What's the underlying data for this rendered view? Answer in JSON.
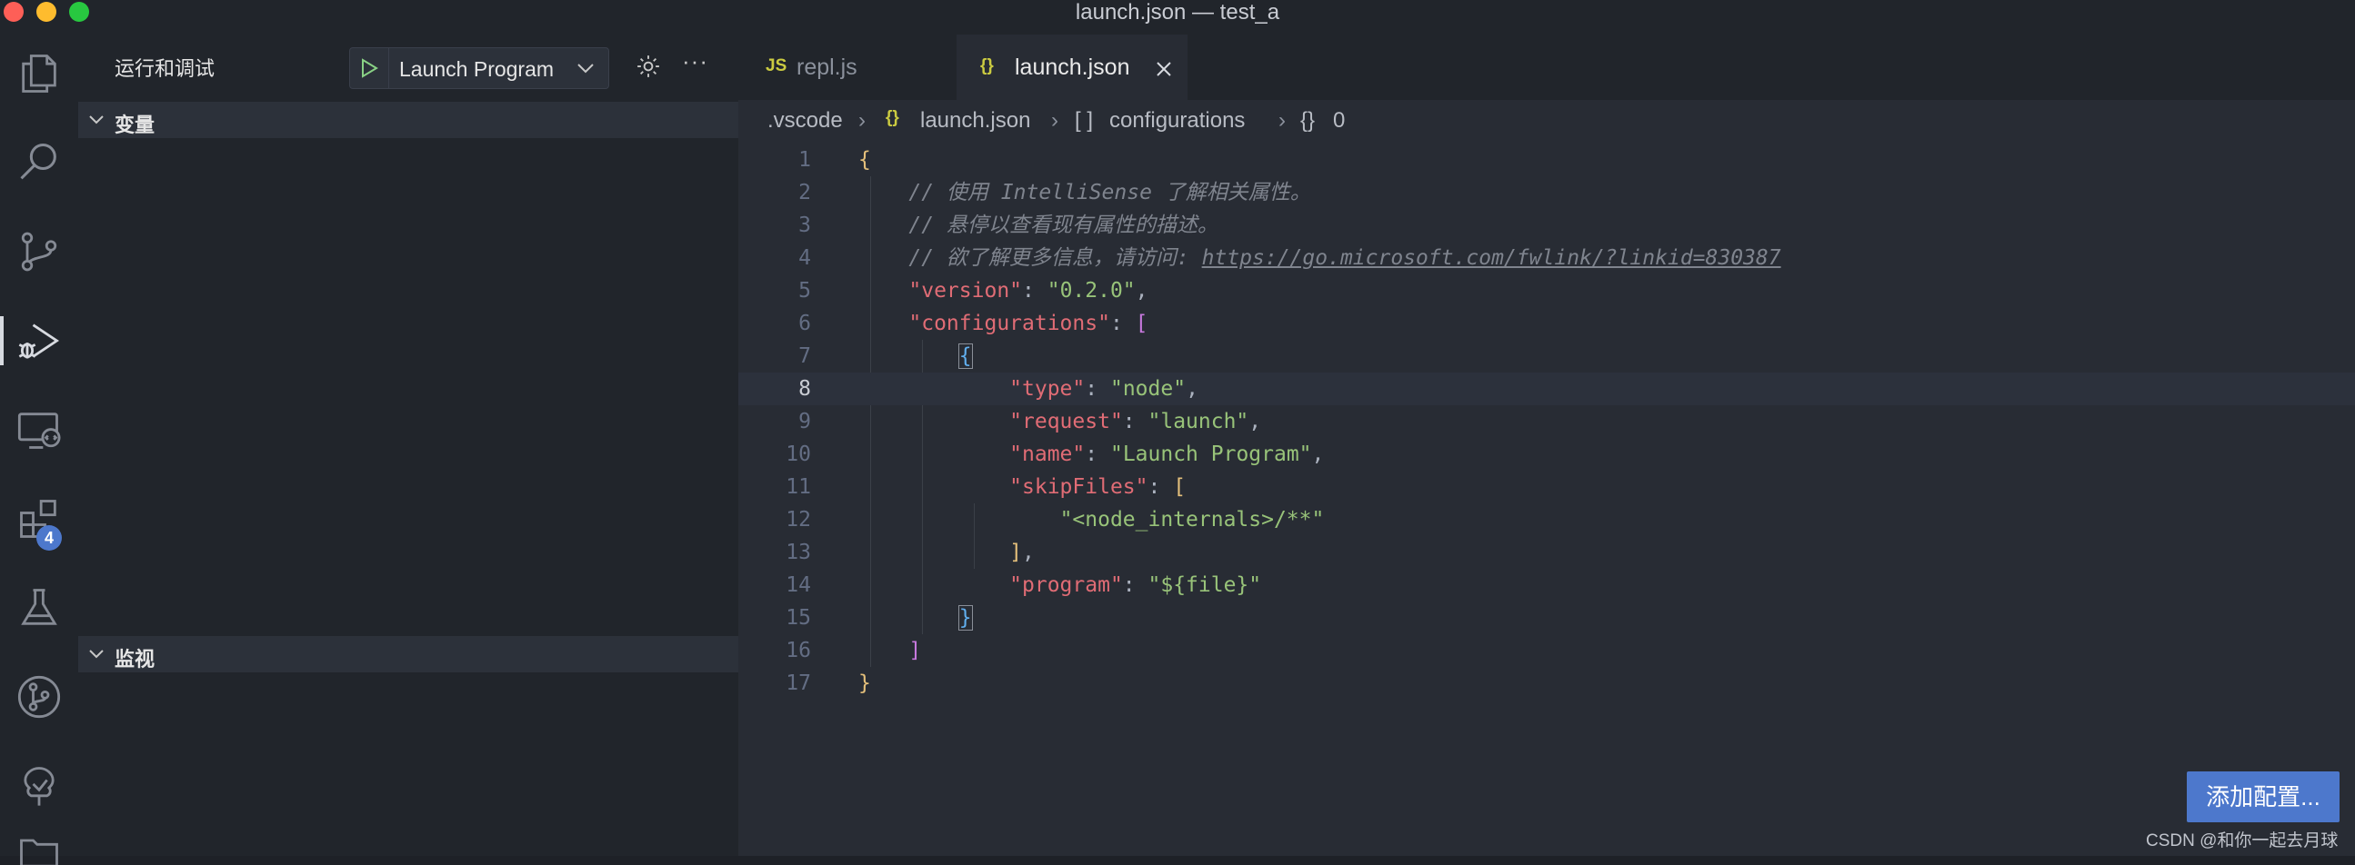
{
  "window": {
    "title": "launch.json — test_a"
  },
  "traffic_lights": {
    "close": "#fe5f57",
    "minimize": "#febc2e",
    "maximize": "#28c840"
  },
  "activity_bar": {
    "items": [
      {
        "name": "explorer-icon"
      },
      {
        "name": "search-icon"
      },
      {
        "name": "source-control-icon"
      },
      {
        "name": "run-debug-icon",
        "active": true
      },
      {
        "name": "remote-explorer-icon"
      },
      {
        "name": "extensions-icon",
        "badge": "4"
      },
      {
        "name": "testing-icon"
      },
      {
        "name": "git-graph-icon"
      },
      {
        "name": "tree-icon"
      }
    ]
  },
  "sidebar": {
    "title": "运行和调试",
    "launch_config": "Launch Program",
    "sections": [
      {
        "label": "变量"
      },
      {
        "label": "监视"
      }
    ]
  },
  "tabs": [
    {
      "icon": "JS",
      "label": "repl.js",
      "active": false
    },
    {
      "icon": "{}",
      "label": "launch.json",
      "active": true
    }
  ],
  "breadcrumb": {
    "folder": ".vscode",
    "file_icon": "{}",
    "file": "launch.json",
    "array_icon": "[ ]",
    "array": "configurations",
    "object_icon": "{}",
    "object": "0"
  },
  "editor": {
    "lines": [
      {
        "n": "1",
        "t": [
          [
            "{",
            "c-b1"
          ]
        ]
      },
      {
        "n": "2",
        "t": [
          [
            "    // 使用 IntelliSense 了解相关属性。",
            "c-com"
          ]
        ]
      },
      {
        "n": "3",
        "t": [
          [
            "    // 悬停以查看现有属性的描述。",
            "c-com"
          ]
        ]
      },
      {
        "n": "4",
        "t": [
          [
            "    // 欲了解更多信息，请访问: ",
            "c-com"
          ],
          [
            "https://go.microsoft.com/fwlink/?linkid=830387",
            "c-link"
          ]
        ]
      },
      {
        "n": "5",
        "t": [
          [
            "    ",
            "c-punc"
          ],
          [
            "\"version\"",
            "c-key"
          ],
          [
            ": ",
            "c-punc"
          ],
          [
            "\"0.2.0\"",
            "c-str"
          ],
          [
            ",",
            "c-punc"
          ]
        ]
      },
      {
        "n": "6",
        "t": [
          [
            "    ",
            "c-punc"
          ],
          [
            "\"configurations\"",
            "c-key"
          ],
          [
            ": ",
            "c-punc"
          ],
          [
            "[",
            "c-b2"
          ]
        ]
      },
      {
        "n": "7",
        "t": [
          [
            "        ",
            "c-punc"
          ],
          [
            "{",
            "c-b3 boxed"
          ]
        ]
      },
      {
        "n": "8",
        "t": [
          [
            "            ",
            "c-punc"
          ],
          [
            "\"type\"",
            "c-key"
          ],
          [
            ": ",
            "c-punc"
          ],
          [
            "\"node\"",
            "c-str"
          ],
          [
            ",",
            "c-punc"
          ]
        ],
        "current": true
      },
      {
        "n": "9",
        "t": [
          [
            "            ",
            "c-punc"
          ],
          [
            "\"request\"",
            "c-key"
          ],
          [
            ": ",
            "c-punc"
          ],
          [
            "\"launch\"",
            "c-str"
          ],
          [
            ",",
            "c-punc"
          ]
        ]
      },
      {
        "n": "10",
        "t": [
          [
            "            ",
            "c-punc"
          ],
          [
            "\"name\"",
            "c-key"
          ],
          [
            ": ",
            "c-punc"
          ],
          [
            "\"Launch Program\"",
            "c-str"
          ],
          [
            ",",
            "c-punc"
          ]
        ]
      },
      {
        "n": "11",
        "t": [
          [
            "            ",
            "c-punc"
          ],
          [
            "\"skipFiles\"",
            "c-key"
          ],
          [
            ": ",
            "c-punc"
          ],
          [
            "[",
            "c-b1"
          ]
        ]
      },
      {
        "n": "12",
        "t": [
          [
            "                ",
            "c-punc"
          ],
          [
            "\"<node_internals>/**\"",
            "c-str"
          ]
        ]
      },
      {
        "n": "13",
        "t": [
          [
            "            ",
            "c-punc"
          ],
          [
            "]",
            "c-b1"
          ],
          [
            ",",
            "c-punc"
          ]
        ]
      },
      {
        "n": "14",
        "t": [
          [
            "            ",
            "c-punc"
          ],
          [
            "\"program\"",
            "c-key"
          ],
          [
            ": ",
            "c-punc"
          ],
          [
            "\"${file}\"",
            "c-str"
          ]
        ]
      },
      {
        "n": "15",
        "t": [
          [
            "        ",
            "c-punc"
          ],
          [
            "}",
            "c-b3 boxed"
          ]
        ]
      },
      {
        "n": "16",
        "t": [
          [
            "    ",
            "c-punc"
          ],
          [
            "]",
            "c-b2"
          ]
        ]
      },
      {
        "n": "17",
        "t": [
          [
            "}",
            "c-b1"
          ]
        ]
      }
    ]
  },
  "add_config_button": "添加配置...",
  "watermark": "CSDN @和你一起去月球"
}
